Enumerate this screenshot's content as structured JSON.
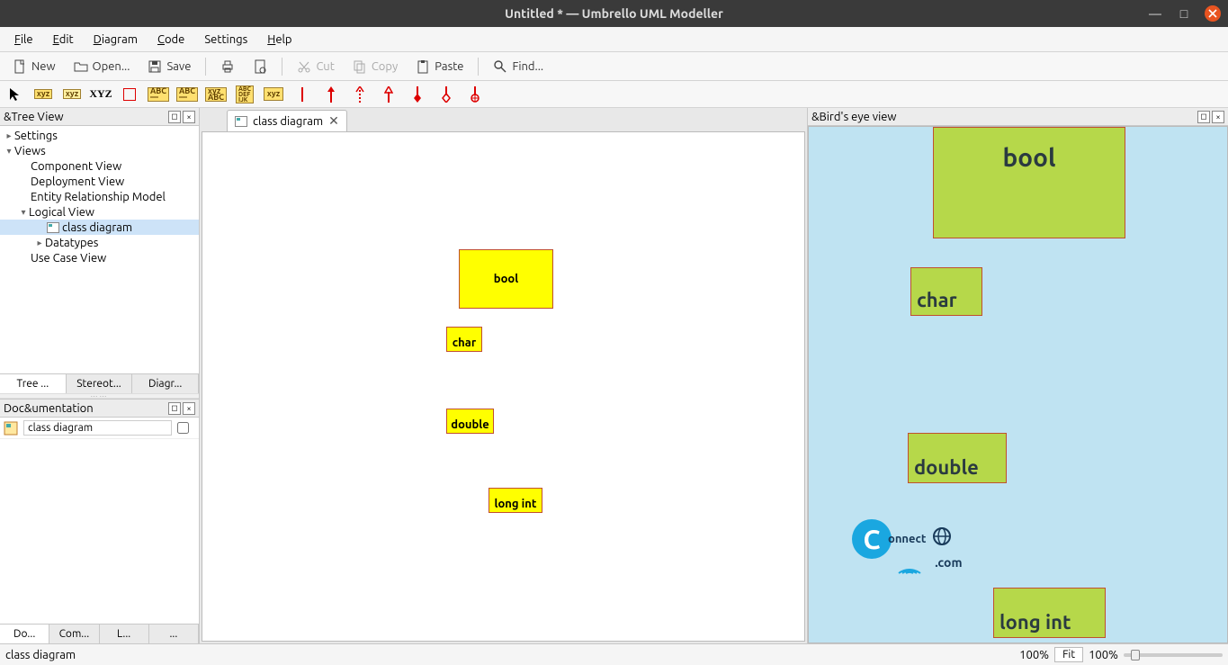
{
  "window": {
    "title": "Untitled * — Umbrello UML Modeller"
  },
  "menu": {
    "file": "File",
    "edit": "Edit",
    "diagram": "Diagram",
    "code": "Code",
    "settings": "Settings",
    "help": "Help"
  },
  "toolbar": {
    "new": "New",
    "open": "Open...",
    "save": "Save",
    "cut": "Cut",
    "copy": "Copy",
    "paste": "Paste",
    "find": "Find..."
  },
  "tree": {
    "header": "&Tree View",
    "settings": "Settings",
    "views": "Views",
    "component": "Component View",
    "deployment": "Deployment View",
    "erm": "Entity Relationship Model",
    "logical": "Logical View",
    "classdiagram": "class diagram",
    "datatypes": "Datatypes",
    "usecase": "Use Case View",
    "tabs": {
      "tree": "Tree ...",
      "stereo": "Stereot...",
      "diag": "Diagr..."
    }
  },
  "doc": {
    "header": "Doc&umentation",
    "value": "class diagram",
    "tabs": {
      "do": "Do...",
      "com": "Com...",
      "l": "L...",
      "more": "..."
    }
  },
  "canvas": {
    "tab": "class diagram",
    "shapes": {
      "bool": "bool",
      "char": "char",
      "double": "double",
      "longint": "long int"
    }
  },
  "birdseye": {
    "header": "&Bird's eye view",
    "shapes": {
      "bool": "bool",
      "char": "char",
      "double": "double",
      "longint": "long int"
    },
    "logo": {
      "text": "onnect",
      "sub": ".com"
    }
  },
  "status": {
    "text": "class diagram",
    "pctLeft": "100%",
    "fit": "Fit",
    "pctRight": "100%"
  }
}
